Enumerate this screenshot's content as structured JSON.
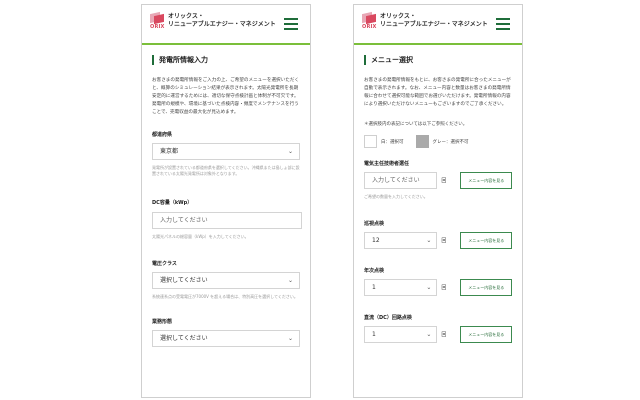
{
  "brand": {
    "logo_mark_text": "ORIX",
    "line1": "オリックス・",
    "line2": "リニューアブルエナジー・マネジメント"
  },
  "left": {
    "section_title": "発電所情報入力",
    "intro": "お客さまの発電所情報をご入力の上、ご希望のメニューを選択いただくと、概算のシミュレーション結果が表示されます。太陽光発電所を長期安定的に運営するためには、適切な保守点検計画と体制が不可欠です。発電所の規模や、環境に基づいた点検内容・頻度でメンテナンスを行うことで、売電収益の最大化が見込めます。",
    "prefecture": {
      "label": "都道府県",
      "value": "東京都",
      "note": "発電所が設置されている都道府県を選択してください。沖縄県または島しょ部に設置されている太陽光発電所は対象外となります。"
    },
    "dc": {
      "label": "DC容量（kWp）",
      "placeholder": "入力してください",
      "note": "太陽光パネルの総容量（kWp）を入力してください。"
    },
    "voltage": {
      "label": "電圧クラス",
      "value": "選択してください",
      "note": "系統連系点の受電電圧が7000V を超える場合は、特別高圧を選択してください。"
    },
    "business": {
      "label": "業務形態",
      "value": "選択してください"
    }
  },
  "right": {
    "section_title": "メニュー選択",
    "intro": "お客さまの発電所情報をもとに、お客さまの発電所に合ったメニューが自動で表示されます。なお、メニュー内容と数量はお客さまの発電所情報に合わせて選択可能な範囲でお選びいただけます。発電所情報の内容により選択いただけないメニューもございますのでご了承ください。",
    "legend_title": "＊選択肢内の表記については以下ご参照ください。",
    "legend_white": "白：選択可",
    "legend_gray": "グレー：選択不可",
    "items": [
      {
        "label": "電気主任技術者選任",
        "value": "入力してください",
        "unit": "回",
        "button": "メニュー内容を見る",
        "note": "ご希望の数量を入力してください。"
      },
      {
        "label": "巡視点検",
        "value": "12",
        "unit": "回",
        "button": "メニュー内容を見る"
      },
      {
        "label": "年次点検",
        "value": "1",
        "unit": "回",
        "button": "メニュー内容を見る"
      },
      {
        "label": "直流（DC）回路点検",
        "value": "1",
        "unit": "回",
        "button": "メニュー内容を見る"
      }
    ]
  },
  "icons": {
    "menu": "hamburger-menu-icon",
    "chevron": "chevron-down-icon"
  },
  "colors": {
    "accent_green": "#1f6d3a",
    "header_line": "#7bbf3a",
    "logo_red": "#d9485f"
  }
}
